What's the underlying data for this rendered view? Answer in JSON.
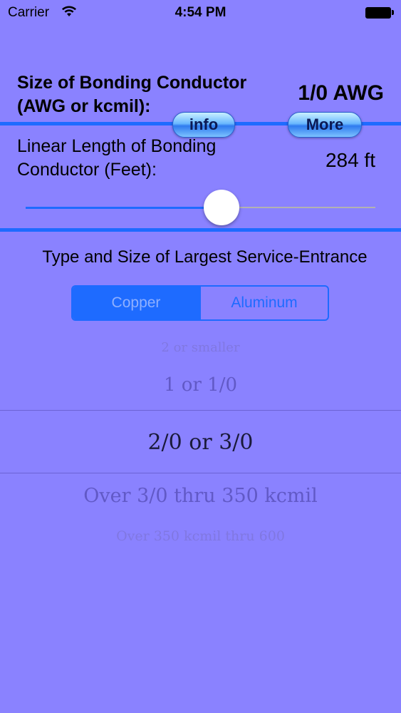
{
  "status_bar": {
    "carrier": "Carrier",
    "time": "4:54 PM"
  },
  "bonding": {
    "size_label_line1": "Size of Bonding Conductor",
    "size_label_line2": "(AWG or kcmil):",
    "size_value": "1/0 AWG",
    "info_label": "info",
    "more_label": "More",
    "length_label_line1": "Linear Length of Bonding",
    "length_label_line2": "Conductor (Feet):",
    "length_value": "284 ft",
    "slider_fraction": 0.56
  },
  "service": {
    "heading": "Type and Size of Largest Service-Entrance",
    "segments": [
      "Copper",
      "Aluminum"
    ],
    "selected_segment": "Copper",
    "picker_items": [
      "2 or smaller",
      "1 or 1/0",
      "2/0 or 3/0",
      "Over 3/0 thru 350 kcmil",
      "Over 350 kcmil thru 600"
    ],
    "selected_item": "2/0 or 3/0"
  },
  "colors": {
    "background": "#8a82ff",
    "accent": "#1e6bff"
  }
}
